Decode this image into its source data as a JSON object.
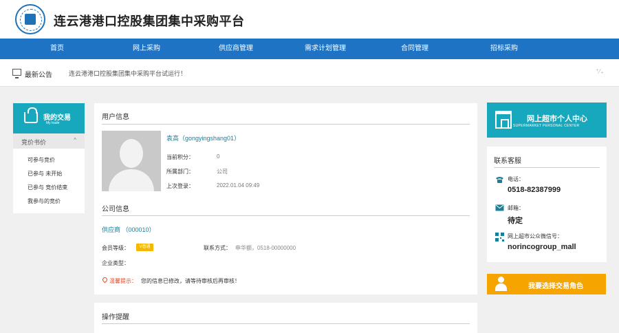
{
  "header": {
    "title": "连云港港口控股集团集中采购平台"
  },
  "nav": {
    "items": [
      "首页",
      "网上采购",
      "供应商管理",
      "需求计划管理",
      "合同管理",
      "招标采购"
    ]
  },
  "notice": {
    "label": "最新公告",
    "text": "连云港港口控股集团集中采购平台试运行！",
    "more": "⁺⁄₊"
  },
  "sidebar": {
    "title": "我的交易",
    "subtitle": "My trade",
    "group_label": "竞价书价",
    "group_arrow": "^",
    "links": [
      "可参与竞价",
      "已参与 未开始",
      "已参与 竞价结束",
      "我参与的竞价"
    ]
  },
  "user_info": {
    "title": "用户信息",
    "name": "袁高（gongyingshang01）",
    "fields": [
      {
        "label": "当前积分：",
        "value": "0"
      },
      {
        "label": "所属部门：",
        "value": "公司"
      },
      {
        "label": "上次登录：",
        "value": "2022.01.04 09:49"
      }
    ]
  },
  "company_info": {
    "title": "公司信息",
    "name": "供应商 （000010）",
    "level_label": "会员等级：",
    "level_badge": "V普通",
    "contact_label": "联系方式：",
    "contact_value": "申华额，0518-00000000",
    "type_label": "企业类型：",
    "warn_label": "温馨提示：",
    "warn_text": "您的信息已修改，请等待审核后再审核！"
  },
  "operation": {
    "title": "操作提醒"
  },
  "supermarket": {
    "title": "网上超市个人中心",
    "subtitle": "SUPERMARKET PERSONAL CENTER"
  },
  "contact": {
    "title": "联系客服",
    "items": [
      {
        "icon": "phone-icon",
        "label": "电话：",
        "value": "0518-82387999"
      },
      {
        "icon": "mail-icon",
        "label": "邮箱：",
        "value": "待定"
      },
      {
        "icon": "qr-icon",
        "label": "网上超市公众微信号：",
        "value": "norincogroup_mall"
      }
    ]
  },
  "role_button": {
    "label": "我要选择交易角色"
  },
  "colors": {
    "nav": "#1e73c4",
    "teal": "#17a8bd",
    "orange": "#f5a400",
    "link": "#1b7f97"
  }
}
